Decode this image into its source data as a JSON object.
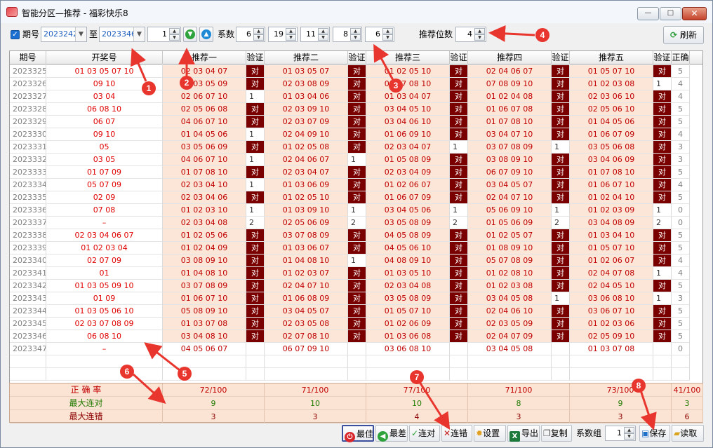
{
  "window": {
    "title": "智能分区—推荐 - 福彩快乐8",
    "min_label": "—",
    "max_label": "□",
    "close_label": "✕"
  },
  "toolbar": {
    "period_checkbox_label": "期号",
    "period_from": "2023242",
    "to_label": "至",
    "period_to": "2023346",
    "step_value": "1",
    "coef_label": "系数",
    "coefs": [
      "6",
      "19",
      "11",
      "8",
      "6"
    ],
    "digits_label": "推荐位数",
    "digits_value": "4",
    "refresh_label": "刷新"
  },
  "table": {
    "headers": [
      "期号",
      "开奖号",
      "推荐一",
      "验证",
      "推荐二",
      "验证",
      "推荐三",
      "验证",
      "推荐四",
      "验证",
      "推荐五",
      "验证",
      "正确"
    ],
    "rows": [
      {
        "p": "2023325",
        "d": "01 03 05 07 10",
        "r1": "02 03 04 07",
        "v1": "对",
        "r2": "01 03 05 07",
        "v2": "对",
        "r3": "01 02 05 10",
        "v3": "对",
        "r4": "02 04 06 07",
        "v4": "对",
        "r5": "01 05 07 10",
        "v5": "对",
        "n": "5"
      },
      {
        "p": "2023326",
        "d": "09 10",
        "r1": "02 03 05 09",
        "v1": "对",
        "r2": "02 03 08 09",
        "v2": "对",
        "r3": "01 07 08 10",
        "v3": "对",
        "r4": "07 08 09 10",
        "v4": "对",
        "r5": "01 02 03 08",
        "v5": "1",
        "n": "4"
      },
      {
        "p": "2023327",
        "d": "03 04",
        "r1": "02 06 07 10",
        "v1": "1",
        "r2": "01 03 04 06",
        "v2": "对",
        "r3": "01 03 04 07",
        "v3": "对",
        "r4": "01 02 04 08",
        "v4": "对",
        "r5": "02 03 06 10",
        "v5": "对",
        "n": "4"
      },
      {
        "p": "2023328",
        "d": "06 08 10",
        "r1": "02 05 06 08",
        "v1": "对",
        "r2": "02 03 09 10",
        "v2": "对",
        "r3": "03 04 05 10",
        "v3": "对",
        "r4": "01 06 07 08",
        "v4": "对",
        "r5": "02 05 06 10",
        "v5": "对",
        "n": "5"
      },
      {
        "p": "2023329",
        "d": "06 07",
        "r1": "04 06 07 10",
        "v1": "对",
        "r2": "02 03 07 09",
        "v2": "对",
        "r3": "03 04 06 10",
        "v3": "对",
        "r4": "01 07 08 10",
        "v4": "对",
        "r5": "01 04 05 06",
        "v5": "对",
        "n": "5"
      },
      {
        "p": "2023330",
        "d": "09 10",
        "r1": "01 04 05 06",
        "v1": "1",
        "r2": "02 04 09 10",
        "v2": "对",
        "r3": "01 06 09 10",
        "v3": "对",
        "r4": "03 04 07 10",
        "v4": "对",
        "r5": "01 06 07 09",
        "v5": "对",
        "n": "4"
      },
      {
        "p": "2023331",
        "d": "05",
        "r1": "03 05 06 09",
        "v1": "对",
        "r2": "01 02 05 08",
        "v2": "对",
        "r3": "02 03 04 07",
        "v3": "1",
        "r4": "03 07 08 09",
        "v4": "1",
        "r5": "03 05 06 08",
        "v5": "对",
        "n": "3"
      },
      {
        "p": "2023332",
        "d": "03 05",
        "r1": "04 06 07 10",
        "v1": "1",
        "r2": "02 04 06 07",
        "v2": "1",
        "r3": "01 05 08 09",
        "v3": "对",
        "r4": "03 08 09 10",
        "v4": "对",
        "r5": "03 04 06 09",
        "v5": "对",
        "n": "3"
      },
      {
        "p": "2023333",
        "d": "01 07 09",
        "r1": "01 07 08 10",
        "v1": "对",
        "r2": "02 03 04 07",
        "v2": "对",
        "r3": "02 03 04 09",
        "v3": "对",
        "r4": "06 07 09 10",
        "v4": "对",
        "r5": "01 07 08 10",
        "v5": "对",
        "n": "5"
      },
      {
        "p": "2023334",
        "d": "05 07 09",
        "r1": "02 03 04 10",
        "v1": "1",
        "r2": "01 03 06 09",
        "v2": "对",
        "r3": "01 02 06 07",
        "v3": "对",
        "r4": "03 04 05 07",
        "v4": "对",
        "r5": "01 06 07 10",
        "v5": "对",
        "n": "4"
      },
      {
        "p": "2023335",
        "d": "02 09",
        "r1": "02 03 04 06",
        "v1": "对",
        "r2": "01 02 05 10",
        "v2": "对",
        "r3": "01 06 07 09",
        "v3": "对",
        "r4": "02 04 07 10",
        "v4": "对",
        "r5": "01 02 04 10",
        "v5": "对",
        "n": "5"
      },
      {
        "p": "2023336",
        "d": "07 08",
        "r1": "01 02 03 10",
        "v1": "1",
        "r2": "01 03 09 10",
        "v2": "1",
        "r3": "03 04 05 06",
        "v3": "1",
        "r4": "05 06 09 10",
        "v4": "1",
        "r5": "01 02 03 09",
        "v5": "1",
        "n": "0"
      },
      {
        "p": "2023337",
        "d": "–",
        "r1": "02 03 04 08",
        "v1": "2",
        "r2": "02 05 06 09",
        "v2": "2",
        "r3": "03 05 08 09",
        "v3": "2",
        "r4": "01 05 06 09",
        "v4": "2",
        "r5": "03 04 08 09",
        "v5": "2",
        "n": "0"
      },
      {
        "p": "2023338",
        "d": "02 03 04 06 07",
        "r1": "01 02 05 06",
        "v1": "对",
        "r2": "03 07 08 09",
        "v2": "对",
        "r3": "04 05 08 09",
        "v3": "对",
        "r4": "01 02 05 07",
        "v4": "对",
        "r5": "01 03 04 10",
        "v5": "对",
        "n": "5"
      },
      {
        "p": "2023339",
        "d": "01 02 03 04",
        "r1": "01 02 04 09",
        "v1": "对",
        "r2": "01 03 06 07",
        "v2": "对",
        "r3": "04 05 06 10",
        "v3": "对",
        "r4": "01 08 09 10",
        "v4": "对",
        "r5": "01 05 07 10",
        "v5": "对",
        "n": "5"
      },
      {
        "p": "2023340",
        "d": "02 07 09",
        "r1": "03 08 09 10",
        "v1": "对",
        "r2": "01 04 08 10",
        "v2": "1",
        "r3": "04 08 09 10",
        "v3": "对",
        "r4": "05 07 08 09",
        "v4": "对",
        "r5": "01 02 06 07",
        "v5": "对",
        "n": "4"
      },
      {
        "p": "2023341",
        "d": "01",
        "r1": "01 04 08 10",
        "v1": "对",
        "r2": "01 02 03 07",
        "v2": "对",
        "r3": "01 03 05 10",
        "v3": "对",
        "r4": "01 02 08 10",
        "v4": "对",
        "r5": "02 04 07 08",
        "v5": "1",
        "n": "4"
      },
      {
        "p": "2023342",
        "d": "01 03 05 09 10",
        "r1": "03 07 08 09",
        "v1": "对",
        "r2": "02 04 07 10",
        "v2": "对",
        "r3": "02 03 04 08",
        "v3": "对",
        "r4": "01 02 03 08",
        "v4": "对",
        "r5": "02 04 05 10",
        "v5": "对",
        "n": "5"
      },
      {
        "p": "2023343",
        "d": "01 09",
        "r1": "01 06 07 10",
        "v1": "对",
        "r2": "01 06 08 09",
        "v2": "对",
        "r3": "03 05 08 09",
        "v3": "对",
        "r4": "03 04 05 08",
        "v4": "1",
        "r5": "03 06 08 10",
        "v5": "1",
        "n": "3"
      },
      {
        "p": "2023344",
        "d": "01 03 05 06 10",
        "r1": "05 08 09 10",
        "v1": "对",
        "r2": "03 04 05 07",
        "v2": "对",
        "r3": "01 05 07 10",
        "v3": "对",
        "r4": "02 04 06 10",
        "v4": "对",
        "r5": "03 06 07 10",
        "v5": "对",
        "n": "5"
      },
      {
        "p": "2023345",
        "d": "02 03 07 08 09",
        "r1": "01 03 07 08",
        "v1": "对",
        "r2": "02 03 05 08",
        "v2": "对",
        "r3": "01 02 06 09",
        "v3": "对",
        "r4": "02 03 05 09",
        "v4": "对",
        "r5": "01 02 03 06",
        "v5": "对",
        "n": "5"
      },
      {
        "p": "2023346",
        "d": "06 08 10",
        "r1": "03 04 08 10",
        "v1": "对",
        "r2": "02 07 08 10",
        "v2": "对",
        "r3": "01 03 06 08",
        "v3": "对",
        "r4": "02 04 07 09",
        "v4": "对",
        "r5": "02 05 09 10",
        "v5": "对",
        "n": "5"
      },
      {
        "p": "2023347",
        "d": "–",
        "r1": "04 05 06 07",
        "v1": "",
        "r2": "06 07 09 10",
        "v2": "",
        "r3": "03 06 08 10",
        "v3": "",
        "r4": "03 04 05 08",
        "v4": "",
        "r5": "01 03 07 08",
        "v5": "",
        "n": "0"
      }
    ]
  },
  "stats": {
    "labels": [
      "正 确 率",
      "最大连对",
      "最大连错"
    ],
    "accuracy": [
      "72/100",
      "71/100",
      "77/100",
      "71/100",
      "73/100",
      "41/100"
    ],
    "max_hit_streak": [
      "9",
      "10",
      "10",
      "8",
      "9",
      "3"
    ],
    "max_miss_streak": [
      "3",
      "3",
      "4",
      "3",
      "3",
      "6"
    ]
  },
  "bottom": {
    "buttons": [
      "最佳",
      "最差",
      "连对",
      "连错",
      "设置",
      "导出",
      "复制"
    ],
    "coef_group_label": "系数组",
    "coef_group_value": "1",
    "save_label": "保存",
    "load_label": "读取"
  },
  "markers": [
    "1",
    "2",
    "3",
    "4",
    "5",
    "6",
    "7",
    "8"
  ],
  "colors": {
    "hit_cell": "#7a0000",
    "rec_bg": "#fbe6d8",
    "draw_text": "#e00000",
    "marker": "#e8352d"
  }
}
